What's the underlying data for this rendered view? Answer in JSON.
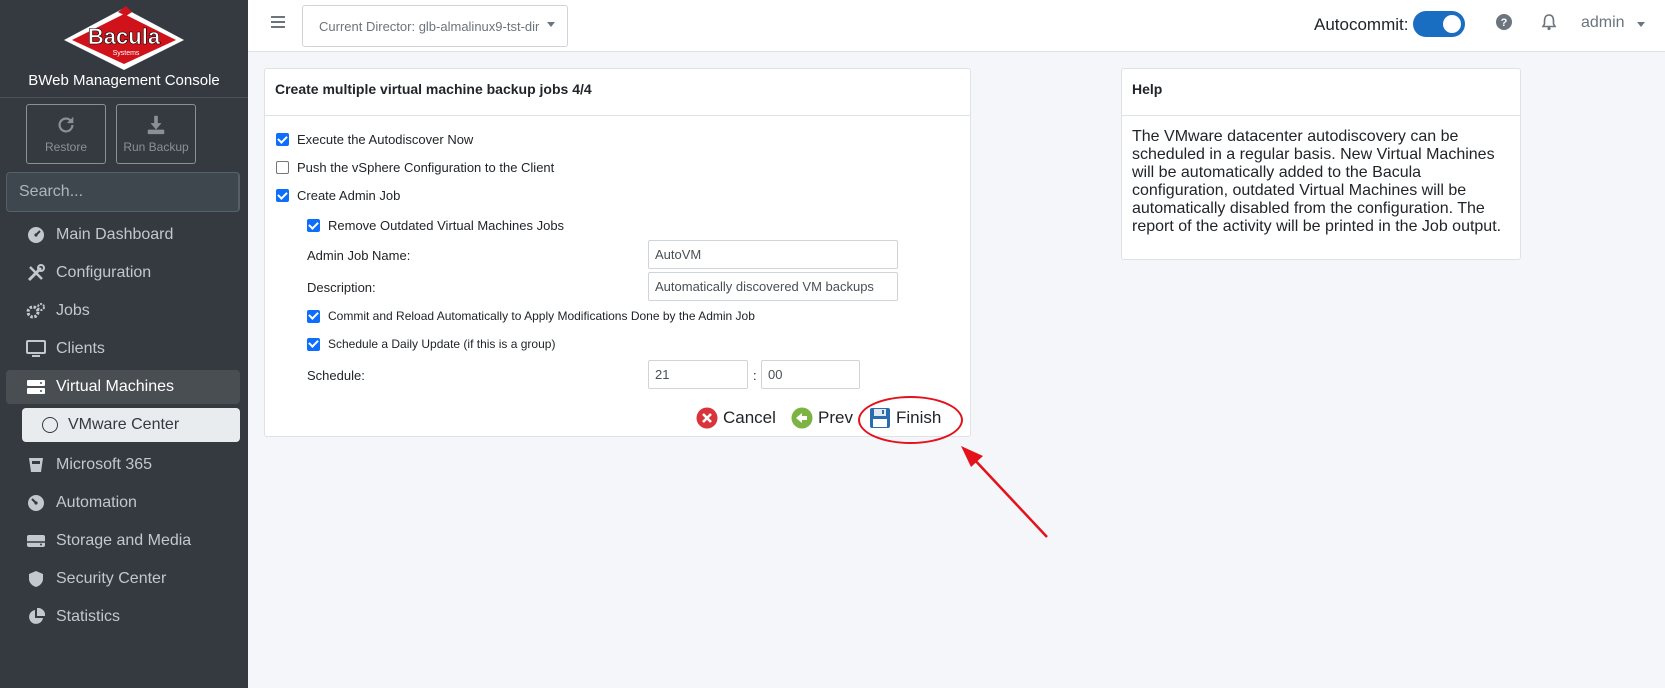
{
  "sidebar": {
    "logo_text": "Bacula",
    "logo_sub": "Systems",
    "brand_title": "BWeb Management Console",
    "quick_actions": [
      {
        "label": "Restore",
        "icon": "restore-icon"
      },
      {
        "label": "Run Backup",
        "icon": "download-icon"
      }
    ],
    "search_placeholder": "Search...",
    "nav": [
      {
        "label": "Main Dashboard",
        "icon": "dashboard-icon"
      },
      {
        "label": "Configuration",
        "icon": "tools-icon"
      },
      {
        "label": "Jobs",
        "icon": "cogs-icon"
      },
      {
        "label": "Clients",
        "icon": "desktop-icon"
      },
      {
        "label": "Virtual Machines",
        "icon": "server-icon",
        "active": true
      },
      {
        "label": "VMware Center",
        "icon": "circle-icon",
        "sub": true
      },
      {
        "label": "Microsoft 365",
        "icon": "bucket-icon"
      },
      {
        "label": "Automation",
        "icon": "gauge-icon"
      },
      {
        "label": "Storage and Media",
        "icon": "hdd-icon"
      },
      {
        "label": "Security Center",
        "icon": "shield-icon"
      },
      {
        "label": "Statistics",
        "icon": "pie-chart-icon"
      }
    ]
  },
  "topbar": {
    "director": "Current Director: glb-almalinux9-tst-dir",
    "autocommit_label": "Autocommit:",
    "autocommit_on": true,
    "user": "admin"
  },
  "wizard": {
    "title": "Create multiple virtual machine backup jobs 4/4",
    "execute_autodiscover": {
      "label": "Execute the Autodiscover Now",
      "checked": true
    },
    "push_vsphere": {
      "label": "Push the vSphere Configuration to the Client",
      "checked": false
    },
    "create_admin_job": {
      "label": "Create Admin Job",
      "checked": true
    },
    "remove_outdated": {
      "label": "Remove Outdated Virtual Machines Jobs",
      "checked": true
    },
    "admin_job_name_label": "Admin Job Name:",
    "admin_job_name": "AutoVM",
    "description_label": "Description:",
    "description": "Automatically discovered VM backups",
    "commit_reload": {
      "label": "Commit and Reload Automatically to Apply Modifications Done by the Admin Job",
      "checked": true
    },
    "schedule_daily": {
      "label": "Schedule a Daily Update (if this is a group)",
      "checked": true
    },
    "schedule_label": "Schedule:",
    "schedule_hour": "21",
    "schedule_sep": ":",
    "schedule_minute": "00",
    "cancel_label": "Cancel",
    "prev_label": "Prev",
    "finish_label": "Finish"
  },
  "help": {
    "title": "Help",
    "text": "The VMware datacenter autodiscovery can be scheduled in a regular basis. New Virtual Machines will be automatically added to the Bacula configuration, outdated Virtual Machines will be automatically disabled from the configuration. The report of the activity will be printed in the Job output."
  },
  "colors": {
    "sidebar_bg": "#343a40",
    "accent": "#1a6ec2",
    "annotation": "#e3121b",
    "cancel": "#d9343a",
    "prev": "#7cb342"
  }
}
